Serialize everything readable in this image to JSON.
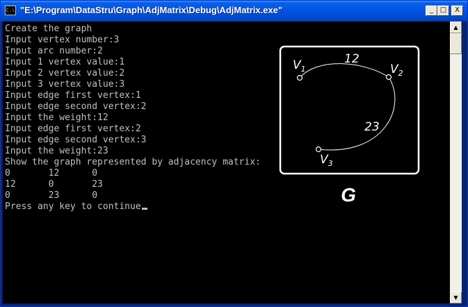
{
  "window": {
    "app_icon_label": "C:\\",
    "title": "\"E:\\Program\\DataStru\\Graph\\AdjMatrix\\Debug\\AdjMatrix.exe\"",
    "controls": {
      "minimize": "_",
      "maximize": "□",
      "close": "X"
    }
  },
  "console": {
    "lines": [
      "Create the graph",
      "Input vertex number:3",
      "Input arc number:2",
      "Input 1 vertex value:1",
      "Input 2 vertex value:2",
      "Input 3 vertex value:3",
      "Input edge first vertex:1",
      "Input edge second vertex:2",
      "Input the weight:12",
      "Input edge first vertex:2",
      "Input edge second vertex:3",
      "Input the weight:23",
      "Show the graph represented by adjacency matrix:",
      "0       12      0",
      "12      0       23",
      "0       23      0",
      "Press any key to continue"
    ]
  },
  "scrollbar": {
    "up_arrow": "▲",
    "down_arrow": "▼"
  },
  "graph": {
    "vertices": [
      {
        "letter": "V",
        "sub": "1"
      },
      {
        "letter": "V",
        "sub": "2"
      },
      {
        "letter": "V",
        "sub": "3"
      }
    ],
    "edges": [
      {
        "weight": "12"
      },
      {
        "weight": "23"
      }
    ],
    "caption": "G"
  }
}
